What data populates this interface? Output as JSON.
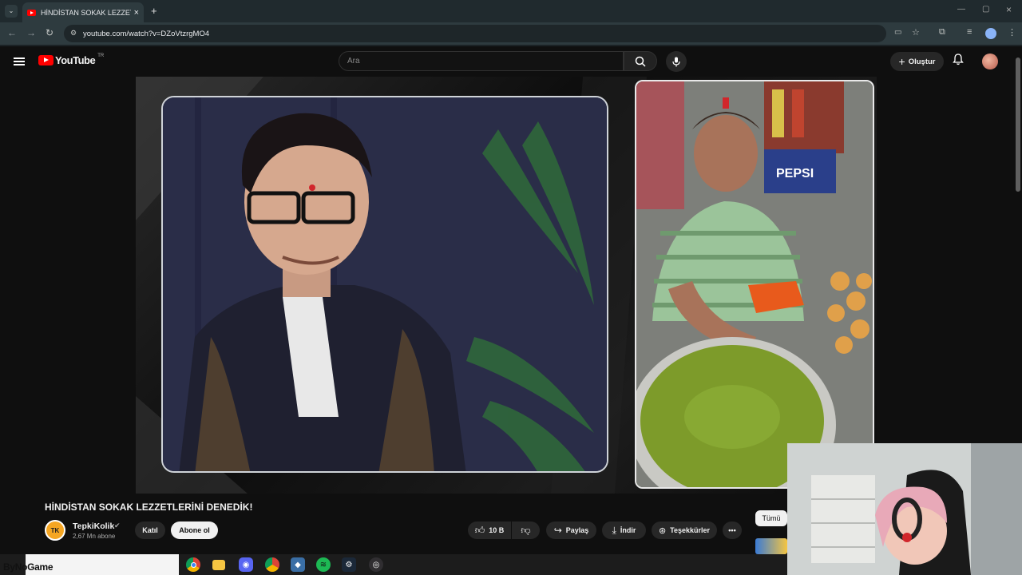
{
  "browser": {
    "tab_title": "HİNDİSTAN SOKAK LEZZETLERİ",
    "url": "youtube.com/watch?v=DZoVtzrgMO4"
  },
  "header": {
    "logo_text": "YouTube",
    "region": "TR",
    "search_placeholder": "Ara",
    "create_label": "Oluştur"
  },
  "video": {
    "title": "HİNDİSTAN SOKAK LEZZETLERİNİ DENEDİK!",
    "pepsi_text": "PEPSI"
  },
  "channel": {
    "avatar_text": "TK",
    "name": "TepkiKolik",
    "subscribers": "2,67 Mn abone",
    "join_label": "Katıl",
    "subscribe_label": "Abone ol"
  },
  "actions": {
    "likes": "10 B",
    "share_label": "Paylaş",
    "download_label": "İndir",
    "thanks_label": "Teşekkürler"
  },
  "sidebar": {
    "chip_all": "Tümü"
  },
  "overlay": {
    "brand": "ByNoGame"
  },
  "colors": {
    "yt_red": "#ff0000",
    "background": "#0f0f0f",
    "chrome_bg": "#2e3b3f"
  }
}
